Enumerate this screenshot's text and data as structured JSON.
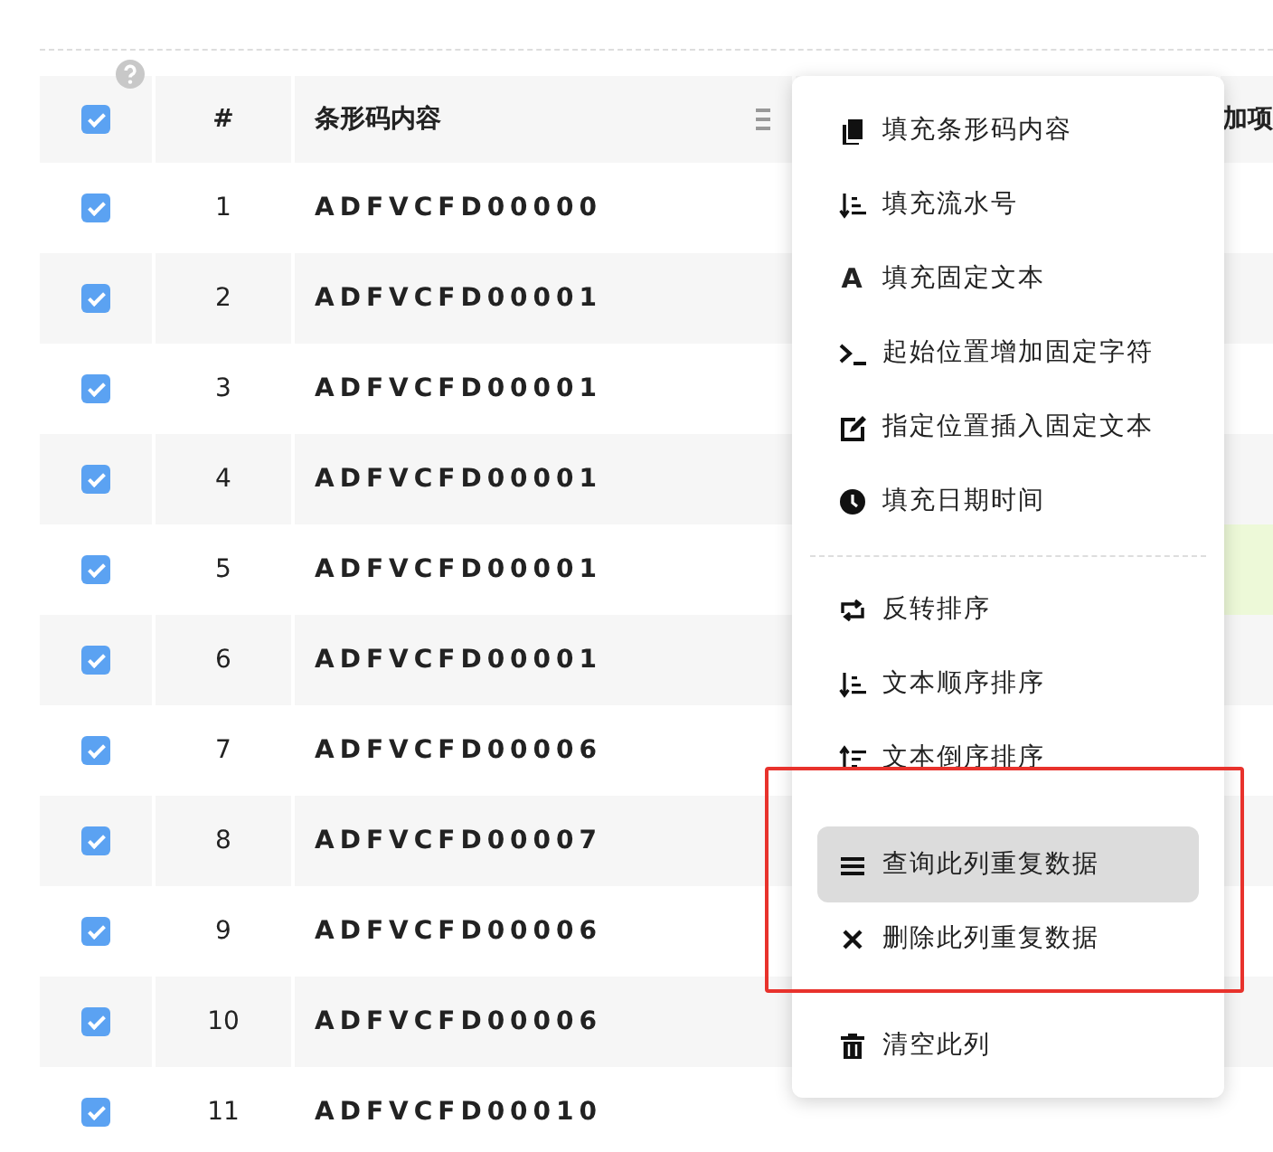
{
  "table": {
    "header": {
      "checked": true,
      "number": "#",
      "content": "条形码内容",
      "column_5": "加项"
    },
    "rows": [
      {
        "checked": true,
        "number": "1",
        "content": "ADFVCFD00000",
        "highlighted": false
      },
      {
        "checked": true,
        "number": "2",
        "content": "ADFVCFD00001",
        "highlighted": false
      },
      {
        "checked": true,
        "number": "3",
        "content": "ADFVCFD00001",
        "highlighted": false
      },
      {
        "checked": true,
        "number": "4",
        "content": "ADFVCFD00001",
        "highlighted": false
      },
      {
        "checked": true,
        "number": "5",
        "content": "ADFVCFD00001",
        "highlighted": true
      },
      {
        "checked": true,
        "number": "6",
        "content": "ADFVCFD00001",
        "highlighted": false
      },
      {
        "checked": true,
        "number": "7",
        "content": "ADFVCFD00006",
        "highlighted": false
      },
      {
        "checked": true,
        "number": "8",
        "content": "ADFVCFD00007",
        "highlighted": false
      },
      {
        "checked": true,
        "number": "9",
        "content": "ADFVCFD00006",
        "highlighted": false
      },
      {
        "checked": true,
        "number": "10",
        "content": "ADFVCFD00006",
        "highlighted": false
      },
      {
        "checked": true,
        "number": "11",
        "content": "ADFVCFD00010",
        "highlighted": false
      }
    ]
  },
  "context_menu": {
    "groups": [
      {
        "dashed_rule_after": true,
        "marked": false,
        "items": [
          {
            "kind": "copy",
            "label": "填充条形码内容",
            "selected": false
          },
          {
            "kind": "sort-asc",
            "label": "填充流水号",
            "selected": false
          },
          {
            "kind": "glyph",
            "glyph": "A",
            "label": "填充固定文本",
            "selected": false
          },
          {
            "kind": "terminal",
            "label": "起始位置增加固定字符",
            "selected": false
          },
          {
            "kind": "edit",
            "label": "指定位置插入固定文本",
            "selected": false
          },
          {
            "kind": "clock",
            "label": "填充日期时间",
            "selected": false
          }
        ]
      },
      {
        "dashed_rule_after": false,
        "marked": false,
        "items": [
          {
            "kind": "swap",
            "label": "反转排序",
            "selected": false
          },
          {
            "kind": "sort-asc",
            "label": "文本顺序排序",
            "selected": false
          },
          {
            "kind": "sort-desc",
            "label": "文本倒序排序",
            "selected": false
          }
        ]
      },
      {
        "dashed_rule_after": false,
        "marked": true,
        "items": [
          {
            "kind": "bars",
            "label": "查询此列重复数据",
            "selected": true
          },
          {
            "kind": "times",
            "label": "删除此列重复数据",
            "selected": false
          }
        ]
      },
      {
        "dashed_rule_after": false,
        "marked": false,
        "items": [
          {
            "kind": "trash",
            "label": "清空此列",
            "selected": false
          }
        ]
      }
    ]
  }
}
